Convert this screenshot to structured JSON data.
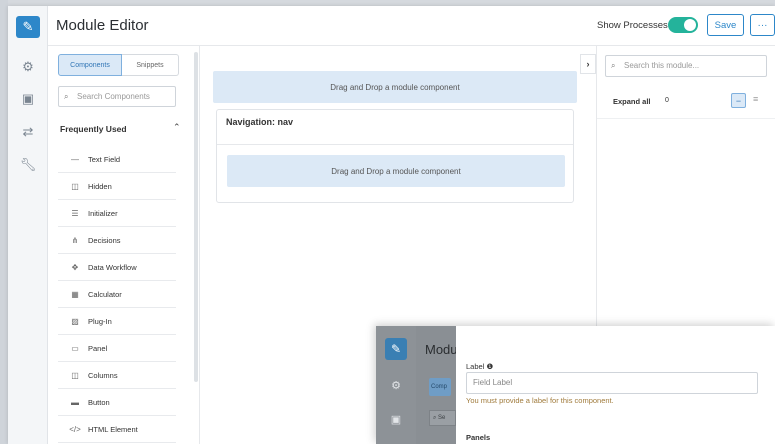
{
  "header": {
    "title": "Module Editor",
    "show_processes_label": "Show Processes",
    "show_processes_on": true,
    "save_label": "Save",
    "more_label": "···"
  },
  "rail": {
    "icons": [
      "edit-icon",
      "gears-icon",
      "module-icon",
      "arrows-icon",
      "wrench-icon"
    ]
  },
  "components": {
    "tabs": [
      {
        "label": "Components",
        "active": true
      },
      {
        "label": "Snippets",
        "active": false
      }
    ],
    "search_placeholder": "Search Components",
    "section_title": "Frequently Used",
    "items": [
      {
        "label": "Text Field",
        "icon": "text-field-icon",
        "glyph": "—"
      },
      {
        "label": "Hidden",
        "icon": "hidden-icon",
        "glyph": "◫"
      },
      {
        "label": "Initializer",
        "icon": "initializer-icon",
        "glyph": "☰"
      },
      {
        "label": "Decisions",
        "icon": "decisions-icon",
        "glyph": "⋔"
      },
      {
        "label": "Data Workflow",
        "icon": "data-workflow-icon",
        "glyph": "✥"
      },
      {
        "label": "Calculator",
        "icon": "calculator-icon",
        "glyph": "▦"
      },
      {
        "label": "Plug-In",
        "icon": "plug-in-icon",
        "glyph": "▨"
      },
      {
        "label": "Panel",
        "icon": "panel-icon",
        "glyph": "▭"
      },
      {
        "label": "Columns",
        "icon": "columns-icon",
        "glyph": "◫"
      },
      {
        "label": "Button",
        "icon": "button-icon",
        "glyph": "▬"
      },
      {
        "label": "HTML Element",
        "icon": "html-element-icon",
        "glyph": "</>"
      }
    ]
  },
  "canvas": {
    "drop_text": "Drag and Drop a module component",
    "nav_title": "Navigation: nav",
    "nav_drop_text": "Drag and Drop a module component"
  },
  "right_panel": {
    "search_placeholder": "Search this module...",
    "expand_all_label": "Expand all",
    "expand_count": "0"
  },
  "overlay": {
    "title": "Modu",
    "tab_label": "Comp",
    "search_text": "Se",
    "label_field_label": "Label",
    "label_placeholder": "Field Label",
    "error_text": "You must provide a label for this component.",
    "panels_label": "Panels"
  },
  "colors": {
    "accent": "#2d87c9",
    "toggle_on": "#24b39b",
    "dropzone": "#dce9f6",
    "error": "#a07b3c"
  }
}
